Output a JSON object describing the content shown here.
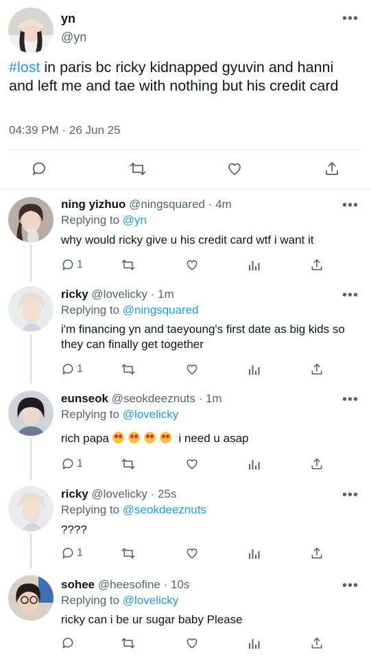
{
  "main_tweet": {
    "name": "yn",
    "handle": "@yn",
    "hashtag": "#lost",
    "text": " in paris bc ricky kidnapped gyuvin and hanni and left me and tae with nothing but his credit card",
    "timestamp": "04:39 PM · 26 Jun 25",
    "more": "•••"
  },
  "replies": [
    {
      "name": "ning yizhuo",
      "meta": " @ningsquared · 4m",
      "replying_prefix": "Replying to ",
      "replying_to": "@yn",
      "text": "why would ricky give u his credit card wtf i want it",
      "reply_count": "1"
    },
    {
      "name": "ricky",
      "meta": " @lovelicky · 1m",
      "replying_prefix": "Replying to ",
      "replying_to": "@ningsquared",
      "text": "i'm financing yn and taeyoung's first date as big kids so they can finally get together",
      "reply_count": "1"
    },
    {
      "name": "eunseok",
      "meta": " @seokdeeznuts · 1m",
      "replying_prefix": "Replying to ",
      "replying_to": "@lovelicky",
      "text_before": "rich papa ",
      "text_after": " i need u asap",
      "reply_count": "1"
    },
    {
      "name": "ricky",
      "meta": " @lovelicky · 25s",
      "replying_prefix": "Replying to ",
      "replying_to": "@seokdeeznuts",
      "text": "????",
      "reply_count": "1"
    },
    {
      "name": "sohee",
      "meta": " @heesofine · 10s",
      "replying_prefix": "Replying to ",
      "replying_to": "@lovelicky",
      "text": "ricky can i be ur sugar baby Please",
      "reply_count": ""
    }
  ],
  "icons": {
    "reply": "reply-icon",
    "retweet": "retweet-icon",
    "like": "heart-icon",
    "analytics": "analytics-icon",
    "share": "share-icon",
    "more": "more-icon"
  },
  "colors": {
    "link": "#1d9bf0",
    "secondary": "#536471",
    "divider": "#e6ecf0"
  }
}
